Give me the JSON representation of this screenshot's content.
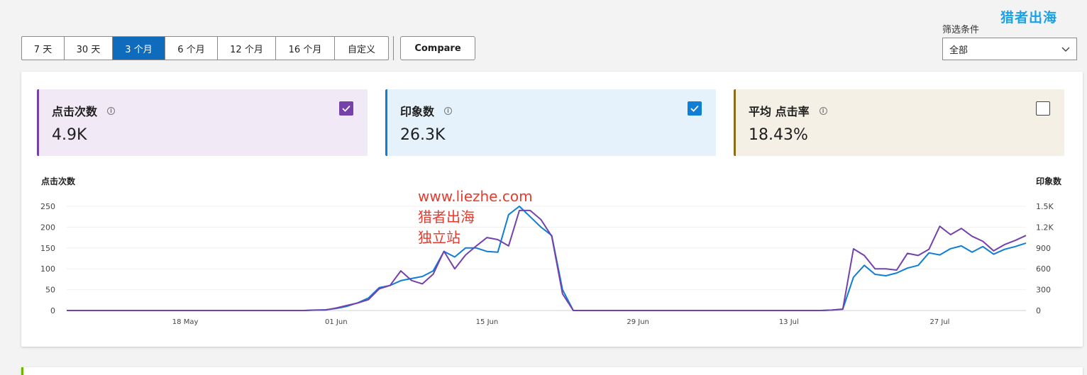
{
  "brand": {
    "logo_text": "猎者出海"
  },
  "date_range": {
    "options": [
      "7 天",
      "30 天",
      "3 个月",
      "6 个月",
      "12 个月",
      "16 个月",
      "自定义"
    ],
    "selected_index": 2
  },
  "compare_label": "Compare",
  "filter": {
    "label": "筛选条件",
    "value": "全部"
  },
  "metrics": [
    {
      "title": "点击次数",
      "value": "4.9K",
      "checked": true,
      "accent": "#7442a9",
      "bg": "#f1eaf6"
    },
    {
      "title": "印象数",
      "value": "26.3K",
      "checked": true,
      "accent": "#0f7ed7",
      "bg": "#e5f1fb"
    },
    {
      "title": "平均 点击率",
      "value": "18.43%",
      "checked": false,
      "accent": "#8a6d1a",
      "bg": "#f4f0e6"
    }
  ],
  "watermark": {
    "lines": [
      "www.liezhe.com",
      "猎者出海",
      "独立站"
    ],
    "color": "#e63b2e"
  },
  "chart_data": {
    "type": "line",
    "left_axis_label": "点击次数",
    "right_axis_label": "印象数",
    "y_left": {
      "min": 0,
      "max": 250,
      "ticks": [
        "0",
        "50",
        "100",
        "150",
        "200",
        "250"
      ]
    },
    "y_right": {
      "min": 0,
      "max": 1500,
      "ticks": [
        "0",
        "300",
        "600",
        "900",
        "1.2K",
        "1.5K"
      ]
    },
    "x_tick_labels": [
      {
        "index": 11,
        "label": "18 May"
      },
      {
        "index": 25,
        "label": "01 Jun"
      },
      {
        "index": 39,
        "label": "15 Jun"
      },
      {
        "index": 53,
        "label": "29 Jun"
      },
      {
        "index": 67,
        "label": "13 Jul"
      },
      {
        "index": 81,
        "label": "27 Jul"
      }
    ],
    "series": [
      {
        "name": "点击次数",
        "axis": "left",
        "color": "#7442a9",
        "values": [
          0,
          0,
          0,
          0,
          0,
          0,
          0,
          0,
          0,
          0,
          0,
          0,
          0,
          0,
          0,
          0,
          0,
          0,
          0,
          0,
          0,
          0,
          0,
          1,
          1,
          6,
          12,
          18,
          26,
          52,
          60,
          95,
          72,
          64,
          87,
          142,
          100,
          133,
          155,
          175,
          170,
          155,
          240,
          240,
          218,
          178,
          40,
          0,
          0,
          0,
          0,
          0,
          0,
          0,
          0,
          0,
          0,
          0,
          0,
          0,
          0,
          0,
          0,
          0,
          0,
          0,
          0,
          0,
          0,
          0,
          0,
          1,
          3,
          148,
          132,
          100,
          100,
          97,
          137,
          132,
          147,
          202,
          182,
          197,
          178,
          166,
          143,
          158,
          168,
          180
        ]
      },
      {
        "name": "印象数",
        "axis": "right",
        "color": "#0f7ed7",
        "values": [
          0,
          0,
          0,
          0,
          0,
          0,
          0,
          0,
          0,
          0,
          0,
          0,
          0,
          0,
          0,
          0,
          0,
          0,
          0,
          0,
          0,
          0,
          0,
          5,
          10,
          30,
          60,
          110,
          180,
          330,
          360,
          430,
          460,
          490,
          570,
          850,
          770,
          900,
          900,
          850,
          840,
          1380,
          1500,
          1350,
          1200,
          1080,
          300,
          0,
          0,
          0,
          0,
          0,
          0,
          0,
          0,
          0,
          0,
          0,
          0,
          0,
          0,
          0,
          0,
          0,
          0,
          0,
          0,
          0,
          0,
          0,
          0,
          6,
          20,
          480,
          650,
          520,
          500,
          540,
          610,
          650,
          830,
          800,
          890,
          930,
          840,
          920,
          810,
          880,
          920,
          970
        ]
      }
    ]
  }
}
